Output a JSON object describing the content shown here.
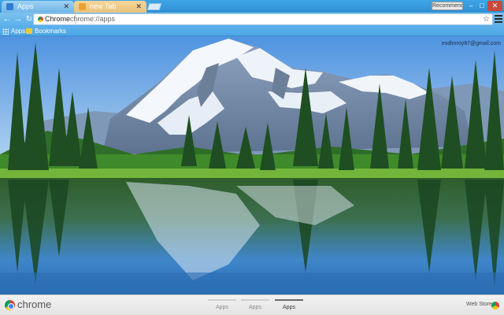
{
  "tabs": [
    {
      "label": "Apps",
      "active": true
    },
    {
      "label": "new Tab",
      "active": false
    }
  ],
  "profile": {
    "name": "Recommend"
  },
  "window_controls": {
    "minimize": "–",
    "maximize": "□",
    "close": "✕"
  },
  "toolbar": {
    "back": "←",
    "forward": "→",
    "reload": "↻",
    "chip_label": "Chrome",
    "url": "chrome://apps",
    "star": "☆"
  },
  "bookmarks": [
    {
      "label": "Apps",
      "icon": "apps-grid-icon"
    },
    {
      "label": "Bookmarks",
      "icon": "folder-icon"
    }
  ],
  "account": {
    "email": "exdimroy87@gmail.com"
  },
  "bottom": {
    "brand": "chrome",
    "pages": [
      {
        "label": "Apps",
        "active": false
      },
      {
        "label": "Apps",
        "active": false
      },
      {
        "label": "Apps",
        "active": true
      }
    ],
    "store_label": "Web Store"
  },
  "theme": {
    "tab_strip": "#2f8fd3",
    "toolbar": "#5bb0ea",
    "close_button": "#c9483c"
  }
}
